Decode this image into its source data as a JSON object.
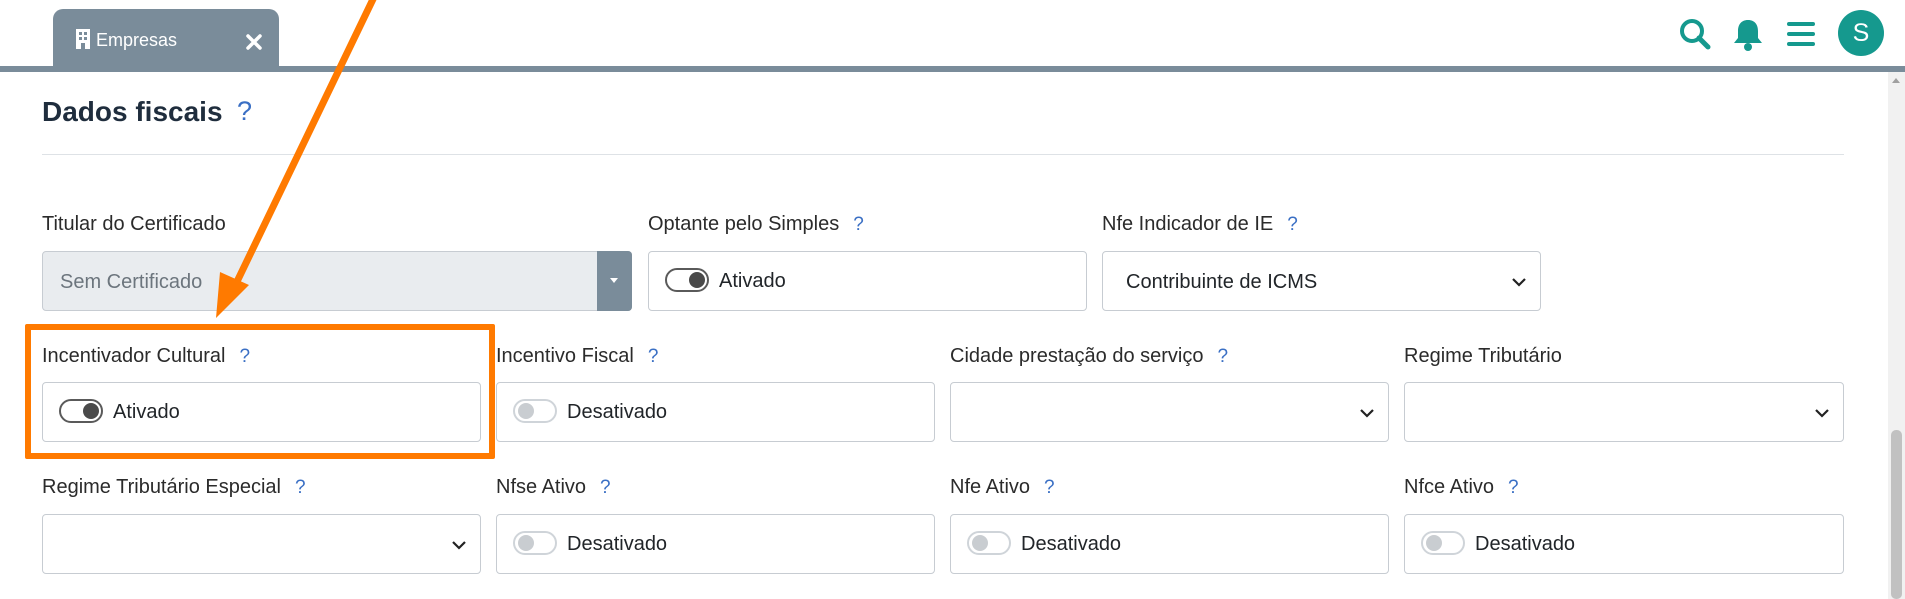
{
  "header": {
    "tab": {
      "label": "Empresas",
      "icon": "building-icon",
      "close_icon": "close-icon"
    },
    "icons": [
      "search-icon",
      "bell-icon",
      "menu-icon"
    ],
    "avatar_initial": "S",
    "accent_color": "#15998e"
  },
  "section": {
    "title": "Dados fiscais",
    "help": "?"
  },
  "fields": {
    "titular": {
      "label": "Titular do Certificado",
      "value": "Sem Certificado"
    },
    "optante": {
      "label": "Optante pelo Simples",
      "help": "?",
      "state": "Ativado",
      "checked": true
    },
    "nfe_ie": {
      "label": "Nfe Indicador de IE",
      "help": "?",
      "value": "Contribuinte de ICMS"
    },
    "incentivador": {
      "label": "Incentivador Cultural",
      "help": "?",
      "state": "Ativado",
      "checked": true
    },
    "incentivo": {
      "label": "Incentivo Fiscal",
      "help": "?",
      "state": "Desativado",
      "checked": false
    },
    "cidade": {
      "label": "Cidade prestação do serviço",
      "help": "?",
      "value": ""
    },
    "regime": {
      "label": "Regime Tributário",
      "value": ""
    },
    "regime_especial": {
      "label": "Regime Tributário Especial",
      "help": "?",
      "value": ""
    },
    "nfse": {
      "label": "Nfse Ativo",
      "help": "?",
      "state": "Desativado",
      "checked": false
    },
    "nfe": {
      "label": "Nfe Ativo",
      "help": "?",
      "state": "Desativado",
      "checked": false
    },
    "nfce": {
      "label": "Nfce Ativo",
      "help": "?",
      "state": "Desativado",
      "checked": false
    }
  },
  "annotation": {
    "color": "#ff7a00"
  }
}
